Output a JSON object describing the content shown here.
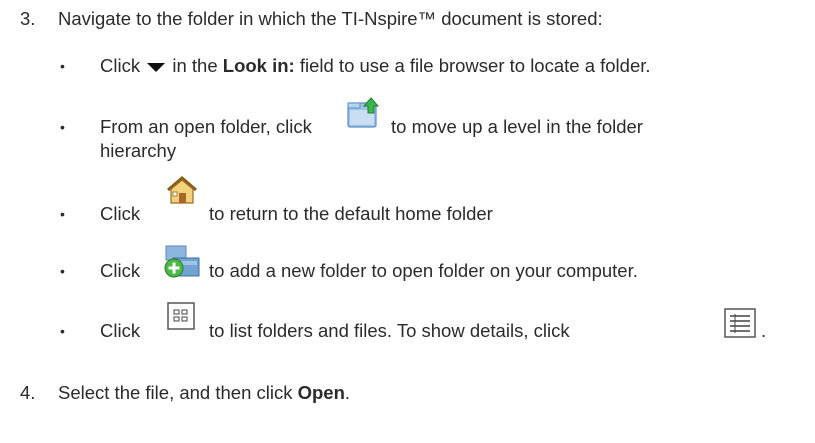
{
  "step3": {
    "number": "3.",
    "text": "Navigate to the folder in which the TI-Nspire™ document is stored:"
  },
  "bullets": {
    "b1": {
      "pre": "Click",
      "mid": "in the",
      "bold": "Look in:",
      "post": "field to use a file browser to locate a folder."
    },
    "b2": {
      "pre": "From an open folder, click",
      "post": "to move up a level in the folder",
      "cont": "hierarchy"
    },
    "b3": {
      "pre": "Click",
      "post": "to return to the default home folder"
    },
    "b4": {
      "pre": "Click",
      "post": "to add a new folder to open folder on your computer."
    },
    "b5": {
      "pre": "Click",
      "post": "to list folders and files. To show details, click",
      "end": "."
    }
  },
  "step4": {
    "number": "4.",
    "pre": "Select the file, and then click",
    "bold": "Open",
    "end": "."
  },
  "icons": {
    "caret": "dropdown-arrow",
    "up": "folder-up",
    "home": "home",
    "new": "new-folder",
    "list": "list-view",
    "details": "details-view"
  }
}
